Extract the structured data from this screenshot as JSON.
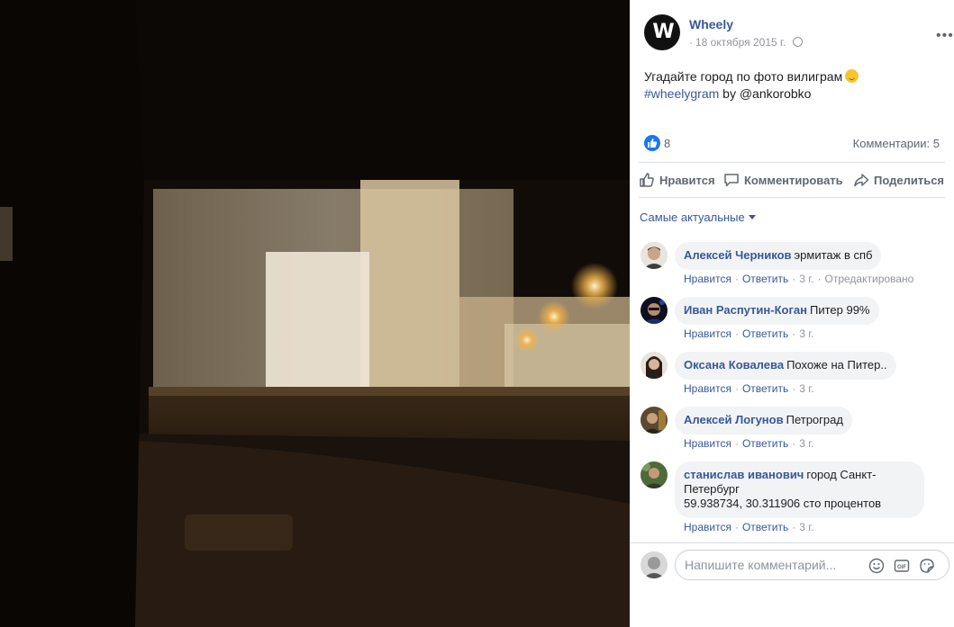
{
  "post": {
    "page_name": "Wheely",
    "avatar_letter": "W",
    "date": "18 октября 2015 г.",
    "text_line1": "Угадайте город по фото вилиграм",
    "hashtag": "#wheelygram",
    "text_by": "by @ankorobko",
    "likes": "8",
    "comments_count": "Комментарии: 5"
  },
  "actions": {
    "like": "Нравится",
    "comment": "Комментировать",
    "share": "Поделиться"
  },
  "sort_label": "Самые актуальные",
  "comment_actions": {
    "like": "Нравится",
    "reply": "Ответить",
    "time": "3 г.",
    "edited": "Отредактировано"
  },
  "comments": [
    {
      "author": "Алексей Черников",
      "text": "эрмитаж в спб"
    },
    {
      "author": "Иван Распутин-Коган",
      "text": "Питер 99%"
    },
    {
      "author": "Оксана Ковалева",
      "text": "Похоже на Питер.."
    },
    {
      "author": "Алексей Логунов",
      "text": "Петроград"
    },
    {
      "author": "станислав иванович",
      "text": "город Санкт-Петербург",
      "text2": "59.938734, 30.311906 сто процентов"
    }
  ],
  "composer": {
    "placeholder": "Напишите комментарий..."
  },
  "colors": {
    "link": "#385898",
    "like_blue": "#1877f2",
    "bubble": "#f2f3f5",
    "muted": "#90949c"
  }
}
